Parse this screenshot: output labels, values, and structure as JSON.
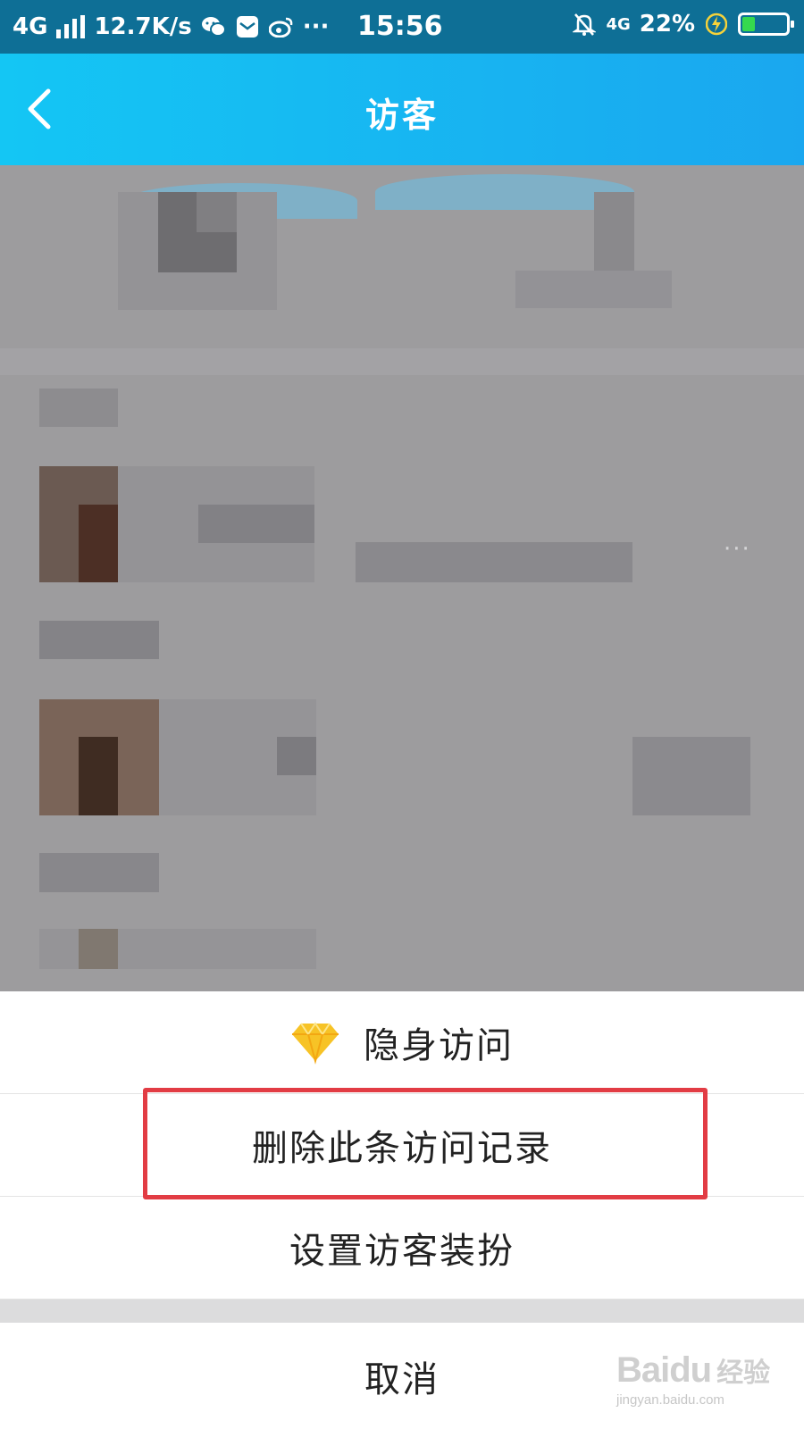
{
  "status_bar": {
    "network": "4G",
    "speed": "12.7K/s",
    "extra": "···",
    "time": "15:56",
    "network_right": "4G",
    "battery": "22%",
    "icons": [
      "signal-icon",
      "wechat-icon",
      "message-icon",
      "weibo-icon",
      "mute-bell-icon",
      "charging-icon",
      "battery-icon"
    ]
  },
  "nav": {
    "title": "访客",
    "back_icon": "back-chevron-icon"
  },
  "list": {
    "more_label": "···"
  },
  "action_sheet": {
    "items": [
      {
        "label": "隐身访问",
        "icon": "diamond-icon"
      },
      {
        "label": "删除此条访问记录",
        "highlighted": true
      },
      {
        "label": "设置访客装扮"
      }
    ],
    "cancel_label": "取消"
  },
  "colors": {
    "status_bar": "#0e6f96",
    "nav_gradient_start": "#14c6f4",
    "nav_gradient_end": "#1aa7ef",
    "highlight_border": "#e23c44",
    "dim_overlay": "#9d9c9e"
  },
  "watermark": {
    "brand": "Baidu",
    "brand_cn": "经验",
    "url": "jingyan.baidu.com"
  }
}
